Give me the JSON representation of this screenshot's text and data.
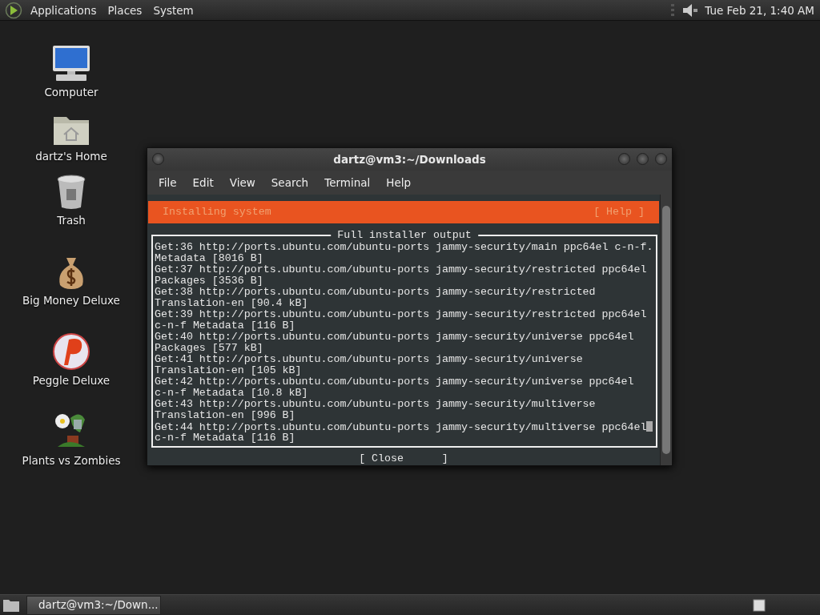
{
  "top_panel": {
    "menus": [
      "Applications",
      "Places",
      "System"
    ],
    "clock": "Tue Feb 21, 1:40 AM"
  },
  "desktop_icons": [
    {
      "label": "Computer",
      "kind": "computer"
    },
    {
      "label": "dartz's Home",
      "kind": "home"
    },
    {
      "label": "Trash",
      "kind": "trash"
    },
    {
      "label": "Big Money Deluxe",
      "kind": "moneybag"
    },
    {
      "label": "Peggle Deluxe",
      "kind": "ball"
    },
    {
      "label": "Plants vs Zombies",
      "kind": "plant"
    }
  ],
  "window": {
    "title": "dartz@vm3:~/Downloads",
    "menu": [
      "File",
      "Edit",
      "View",
      "Search",
      "Terminal",
      "Help"
    ],
    "installer": {
      "header": "Installing system",
      "help": "[ Help ]",
      "box_title": "Full installer output",
      "lines": [
        "Get:36 http://ports.ubuntu.com/ubuntu-ports jammy-security/main ppc64el c-n-f.",
        "Metadata [8016 B]",
        "Get:37 http://ports.ubuntu.com/ubuntu-ports jammy-security/restricted ppc64el",
        "Packages [3536 B]",
        "Get:38 http://ports.ubuntu.com/ubuntu-ports jammy-security/restricted",
        "Translation-en [90.4 kB]",
        "Get:39 http://ports.ubuntu.com/ubuntu-ports jammy-security/restricted ppc64el",
        "c-n-f Metadata [116 B]",
        "Get:40 http://ports.ubuntu.com/ubuntu-ports jammy-security/universe ppc64el",
        "Packages [577 kB]",
        "Get:41 http://ports.ubuntu.com/ubuntu-ports jammy-security/universe",
        "Translation-en [105 kB]",
        "Get:42 http://ports.ubuntu.com/ubuntu-ports jammy-security/universe ppc64el",
        "c-n-f Metadata [10.8 kB]",
        "Get:43 http://ports.ubuntu.com/ubuntu-ports jammy-security/multiverse",
        "Translation-en [996 B]",
        "Get:44 http://ports.ubuntu.com/ubuntu-ports jammy-security/multiverse ppc64el",
        "c-n-f Metadata [116 B]"
      ],
      "close": "[ Close      ]"
    }
  },
  "taskbar": {
    "tasks": [
      {
        "label": "dartz@vm3:~/Down...",
        "selected": true
      }
    ]
  }
}
